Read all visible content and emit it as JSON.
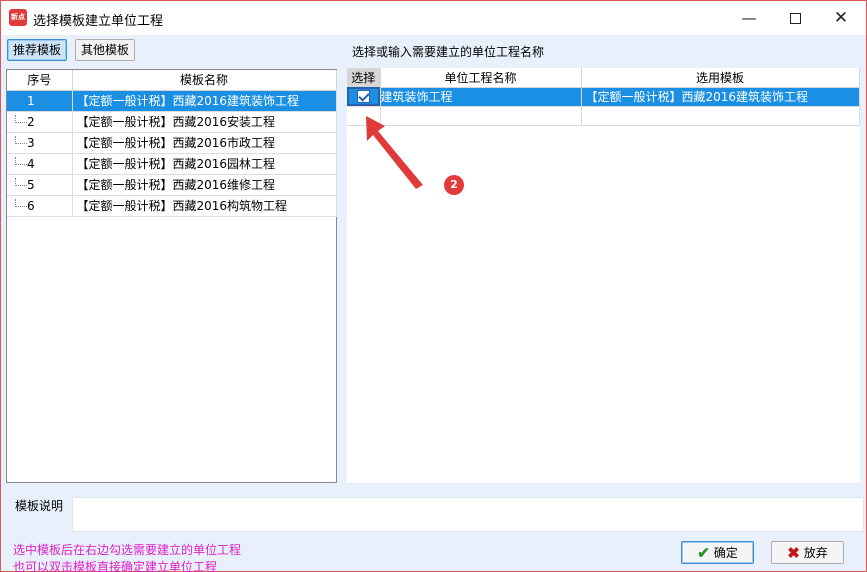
{
  "window": {
    "title": "选择模板建立单位工程",
    "app_icon_text": "新点",
    "minimize_glyph": "—",
    "close_glyph": "✕"
  },
  "tabs": [
    {
      "label": "推荐模板",
      "active": true
    },
    {
      "label": "其他模板",
      "active": false
    }
  ],
  "left_table": {
    "headers": [
      "序号",
      "模板名称"
    ],
    "rows": [
      {
        "no": "1",
        "name": "【定额一般计税】西藏2016建筑装饰工程",
        "selected": true
      },
      {
        "no": "2",
        "name": "【定额一般计税】西藏2016安装工程",
        "selected": false
      },
      {
        "no": "3",
        "name": "【定额一般计税】西藏2016市政工程",
        "selected": false
      },
      {
        "no": "4",
        "name": "【定额一般计税】西藏2016园林工程",
        "selected": false
      },
      {
        "no": "5",
        "name": "【定额一般计税】西藏2016维修工程",
        "selected": false
      },
      {
        "no": "6",
        "name": "【定额一般计税】西藏2016构筑物工程",
        "selected": false
      }
    ]
  },
  "right_section": {
    "label": "选择或输入需要建立的单位工程名称",
    "headers": [
      "选择",
      "单位工程名称",
      "选用模板"
    ],
    "rows": [
      {
        "checked": true,
        "project_name": "建筑装饰工程",
        "template": "【定额一般计税】西藏2016建筑装饰工程"
      }
    ]
  },
  "annotation": {
    "badge_number": "2",
    "color": "#e03a3a"
  },
  "description": {
    "label": "模板说明",
    "value": ""
  },
  "hints": [
    "选中模板后在右边勾选需要建立的单位工程",
    "也可以双击模板直接确定建立单位工程"
  ],
  "buttons": {
    "ok_label": "确定",
    "cancel_label": "放弃"
  },
  "colors": {
    "selection": "#1a8fe3",
    "hint_text": "#e020c8",
    "ok_icon": "#1e9a1e",
    "cancel_icon": "#c01818"
  }
}
